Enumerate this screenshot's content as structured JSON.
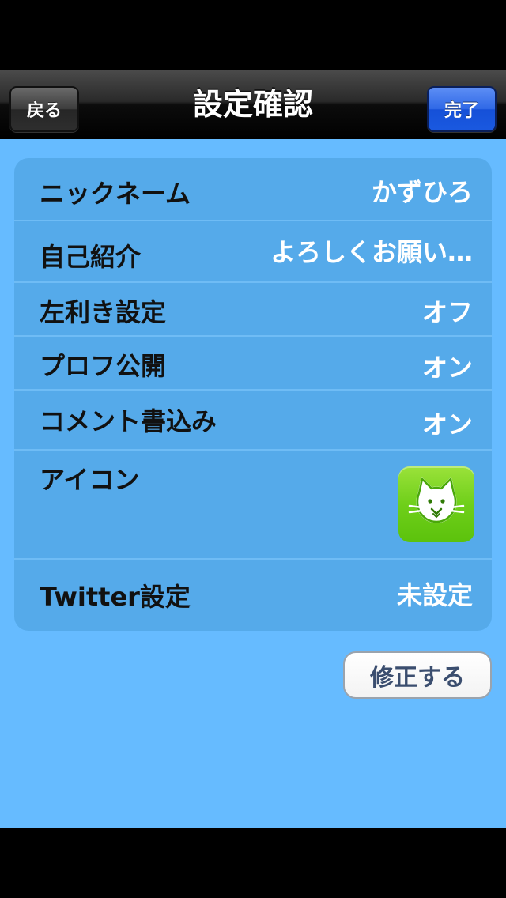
{
  "nav": {
    "title": "設定確認",
    "back_label": "戻る",
    "done_label": "完了"
  },
  "rows": [
    {
      "label": "ニックネーム",
      "value": "かずひろ"
    },
    {
      "label": "自己紹介",
      "value": "よろしくお願い…"
    },
    {
      "label": "左利き設定",
      "value": "オフ"
    },
    {
      "label": "プロフ公開",
      "value": "オン"
    },
    {
      "label": "コメント書込み",
      "value": "オン"
    },
    {
      "label": "アイコン",
      "value_icon": "cat-face-icon"
    },
    {
      "label": "Twitter設定",
      "value": "未設定"
    }
  ],
  "actions": {
    "edit_label": "修正する"
  },
  "colors": {
    "background": "#66bbff",
    "group": "#55aaea",
    "done_button": "#1a59e0",
    "icon_tile": "#6fcf1a"
  }
}
